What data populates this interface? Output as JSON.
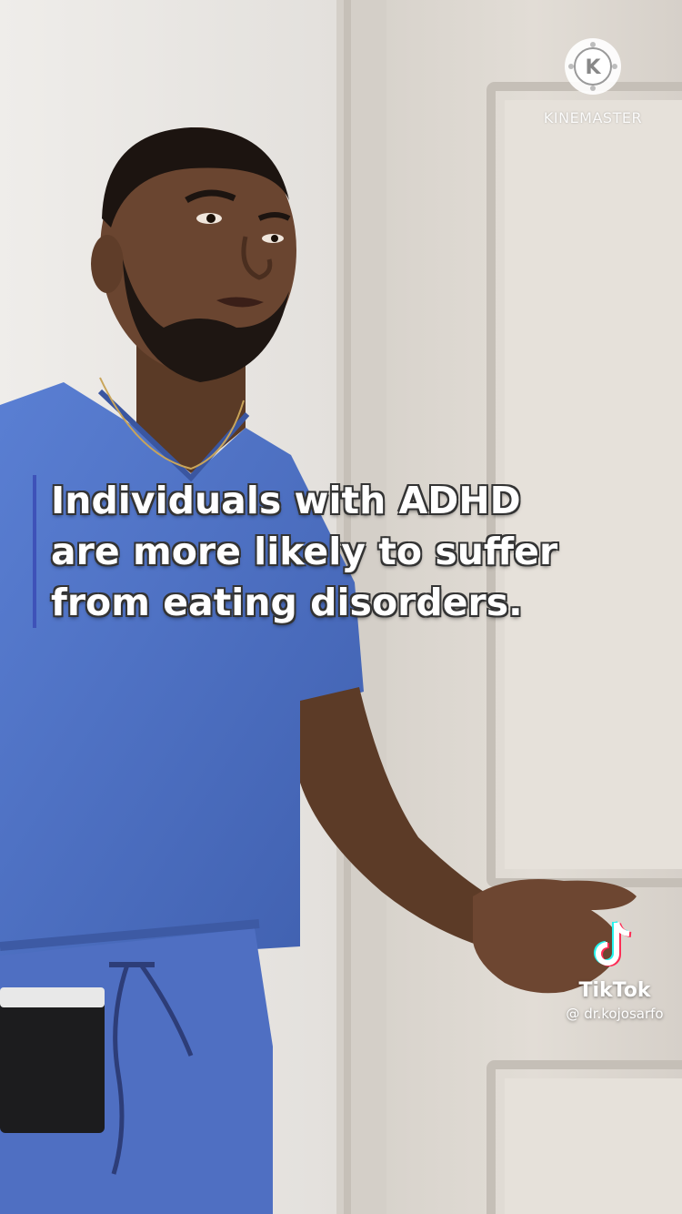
{
  "watermark": {
    "brand": "KINEMASTER",
    "logo_letter": "K",
    "logo_icon": "kinemaster-logo-icon"
  },
  "caption": {
    "lines": [
      "Individuals with ADHD",
      "are more likely to suffer",
      "from eating disorders."
    ],
    "bar_color": "#3e52b8"
  },
  "tiktok": {
    "brand": "TikTok",
    "handle": "@ dr.kojosarfo",
    "logo_icon": "tiktok-logo-icon"
  },
  "colors": {
    "scrubs": "#4f73c7",
    "wall": "#ece9e5",
    "door": "#ddd8d1"
  }
}
